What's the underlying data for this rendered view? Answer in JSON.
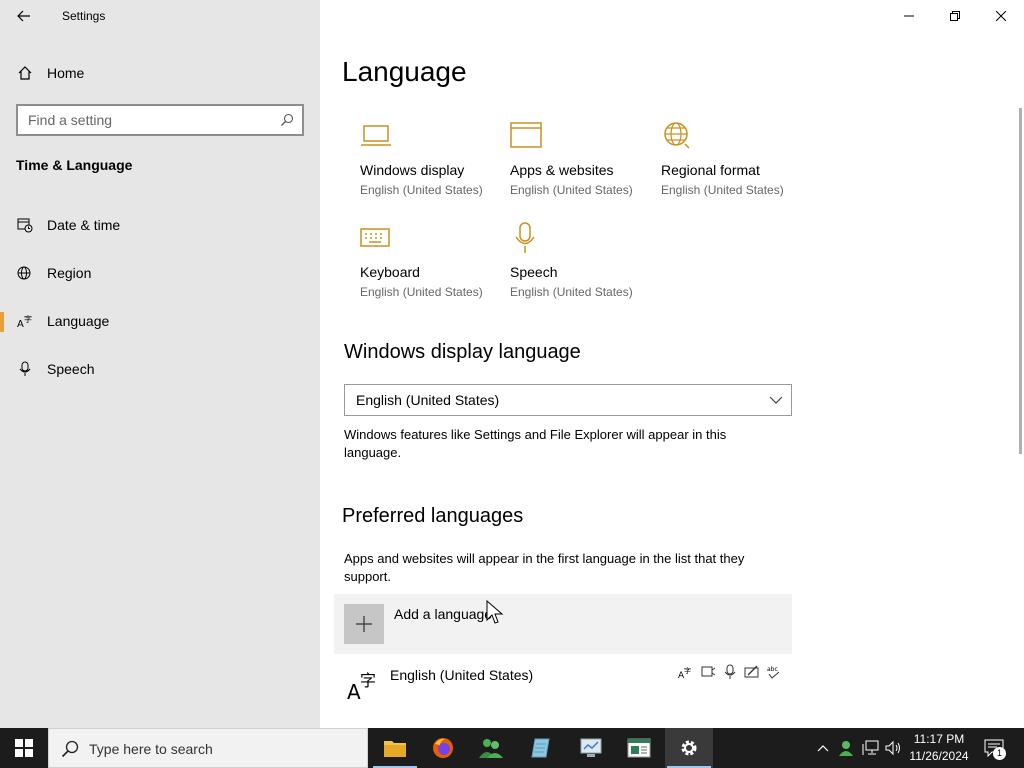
{
  "window": {
    "title": "Settings"
  },
  "sidebar": {
    "home_label": "Home",
    "search_placeholder": "Find a setting",
    "section_title": "Time & Language",
    "items": [
      {
        "label": "Date & time",
        "icon": "calendar-clock-icon"
      },
      {
        "label": "Region",
        "icon": "globe-icon"
      },
      {
        "label": "Language",
        "icon": "language-icon",
        "active": true
      },
      {
        "label": "Speech",
        "icon": "microphone-icon"
      }
    ]
  },
  "main": {
    "title": "Language",
    "tiles": [
      {
        "name": "Windows display",
        "sub": "English (United States)",
        "icon": "laptop-icon"
      },
      {
        "name": "Apps & websites",
        "sub": "English (United States)",
        "icon": "browser-window-icon"
      },
      {
        "name": "Regional format",
        "sub": "English (United States)",
        "icon": "globe-icon"
      },
      {
        "name": "Keyboard",
        "sub": "English (United States)",
        "icon": "keyboard-icon"
      },
      {
        "name": "Speech",
        "sub": "English (United States)",
        "icon": "microphone-icon"
      }
    ],
    "display_language": {
      "heading": "Windows display language",
      "selected": "English (United States)",
      "description": "Windows features like Settings and File Explorer will appear in this language."
    },
    "preferred": {
      "heading": "Preferred languages",
      "description": "Apps and websites will appear in the first language in the list that they support.",
      "add_label": "Add a language",
      "languages": [
        {
          "name": "English (United States)"
        }
      ]
    }
  },
  "taskbar": {
    "search_placeholder": "Type here to search",
    "time": "11:17 PM",
    "date": "11/26/2024",
    "notification_count": "1"
  },
  "colors": {
    "accent": "#c8901e",
    "sidebar_bg": "#e6e6e6",
    "active_bar": "#e8a13a",
    "taskbar_bg": "#1c1c1c"
  }
}
